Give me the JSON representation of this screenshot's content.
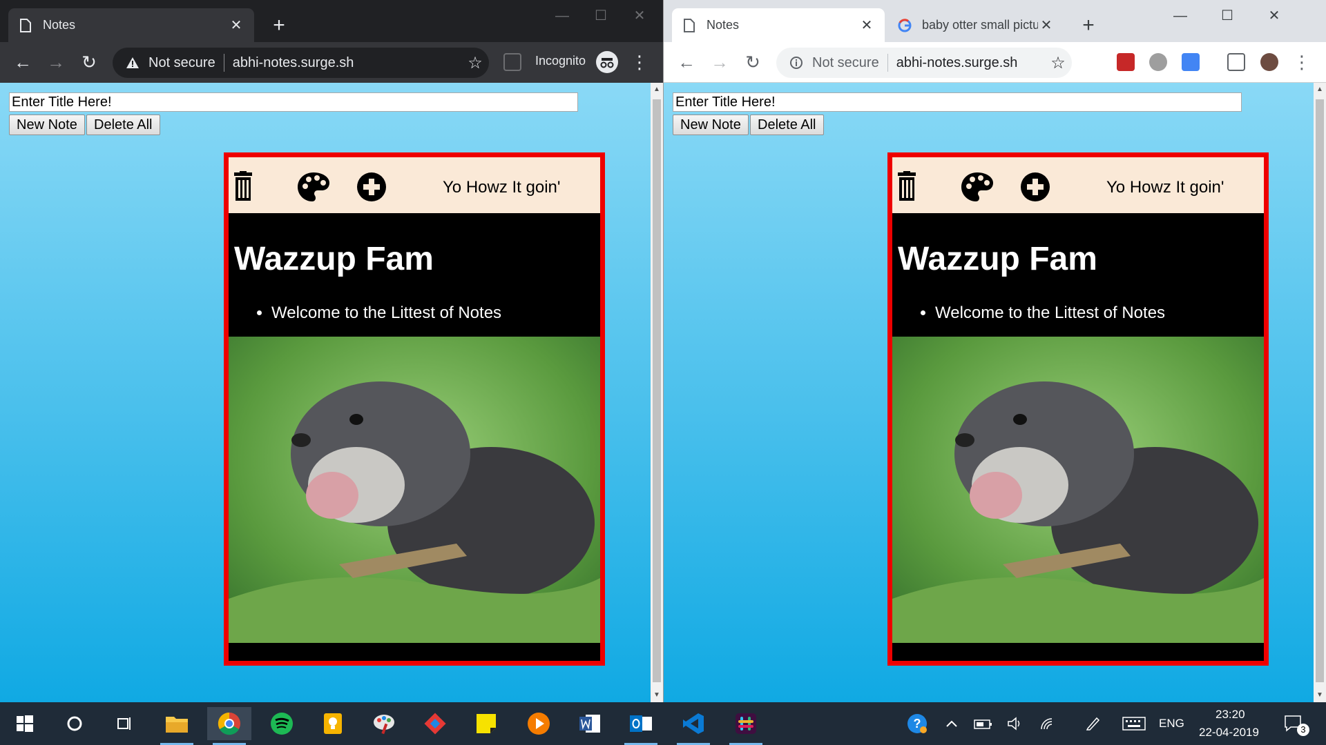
{
  "windows": [
    {
      "mode": "incognito",
      "tabs": [
        {
          "title": "Notes",
          "close": "✕"
        }
      ],
      "new_tab": "+",
      "controls": {
        "minimize": "—",
        "maximize": "☐",
        "close": "✕"
      },
      "toolbar": {
        "back": "←",
        "forward": "→",
        "reload": "↻"
      },
      "omnibox": {
        "security": "Not secure",
        "url": "abhi-notes.surge.sh",
        "star": "☆"
      },
      "incognito_label": "Incognito"
    },
    {
      "mode": "normal",
      "tabs": [
        {
          "title": "Notes",
          "close": "✕"
        },
        {
          "title": "baby otter small picture - G",
          "close": "✕"
        }
      ],
      "new_tab": "+",
      "controls": {
        "minimize": "—",
        "maximize": "☐",
        "close": "✕"
      },
      "toolbar": {
        "back": "←",
        "forward": "→",
        "reload": "↻",
        "menu": "⋮"
      },
      "omnibox": {
        "security": "Not secure",
        "url": "abhi-notes.surge.sh",
        "star": "☆"
      }
    }
  ],
  "page": {
    "title_placeholder": "Enter Title Here!",
    "new_note_label": "New Note",
    "delete_all_label": "Delete All",
    "note": {
      "toolbar_icons": [
        "trash-icon",
        "palette-icon",
        "plus-circle-icon"
      ],
      "subtitle": "Yo Howz It goin'",
      "heading": "Wazzup Fam",
      "items": [
        "Welcome to the Littest of Notes"
      ],
      "border_color": "#e00000",
      "header_bg": "#fae9d7"
    }
  },
  "taskbar": {
    "apps": [
      "windows-start",
      "cortana",
      "task-view",
      "file-explorer",
      "chrome",
      "spotify",
      "keep",
      "paint",
      "git",
      "sticky-notes",
      "plex",
      "word",
      "outlook",
      "vscode",
      "slack"
    ],
    "tray": {
      "language": "ENG",
      "time": "23:20",
      "date": "22-04-2019",
      "notifications": "3"
    }
  },
  "colors": {
    "page_gradient_top": "#8ad9f6",
    "page_gradient_bottom": "#10a9e3",
    "incognito_frame": "#202124",
    "taskbar": "#1f2b38"
  }
}
